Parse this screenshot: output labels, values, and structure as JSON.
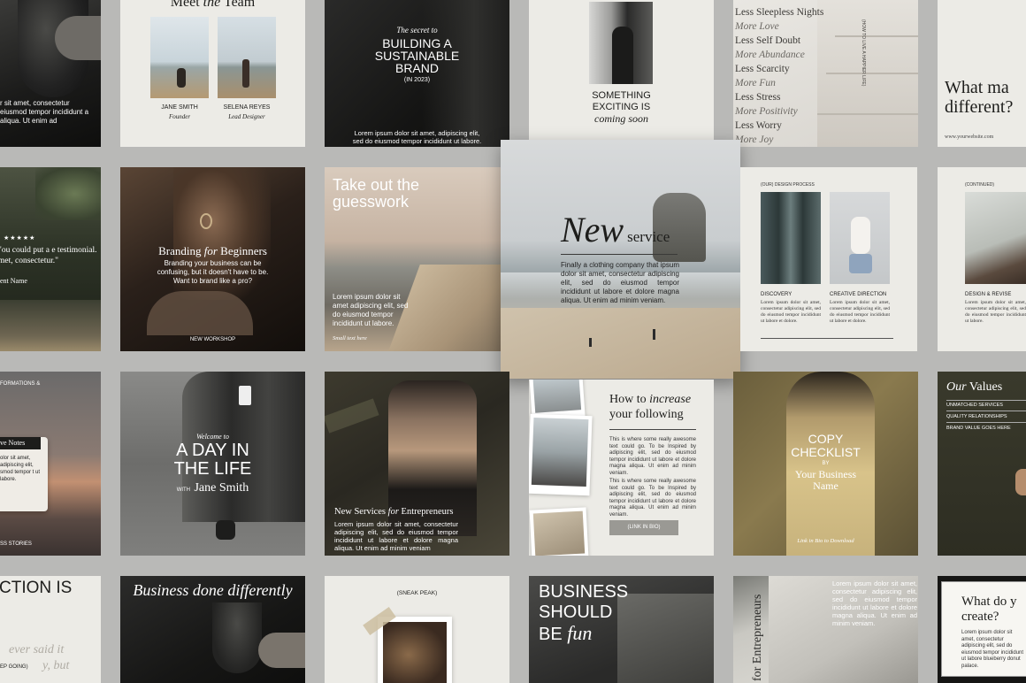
{
  "colors": {
    "background": "#b9b9b7",
    "cream": "#ecebe6",
    "dark": "#222220",
    "olive": "#3b3a30"
  },
  "t1": {
    "text": "r sit amet, consectetur eiusmod tempor incididunt a aliqua. Ut enim ad"
  },
  "t2": {
    "title_a": "Meet",
    "title_b": "the",
    "title_c": "Team",
    "p1_name": "JANE SMITH",
    "p1_role": "Founder",
    "p2_name": "SELENA REYES",
    "p2_role": "Lead Designer"
  },
  "t3": {
    "kicker": "The secret to",
    "headline1": "BUILDING A",
    "headline2": "SUSTAINABLE",
    "headline3": "BRAND",
    "year": "(IN 2023)",
    "body": "Lorem ipsum dolor sit amet, adipiscing elit, sed do eiusmod tempor incididunt ut labore."
  },
  "t4": {
    "line1": "SOMETHING",
    "line2": "EXCITING IS",
    "line3": "coming soon"
  },
  "t5": {
    "items": [
      "Less Stress",
      "More Love",
      "Less Self Doubt",
      "More Abundance",
      "Less Scarcity",
      "More Fun",
      "Less Stress",
      "More Positivity",
      "Less Worry",
      "More Joy"
    ],
    "top_item": "Less Sleepless Nights",
    "side_text": "(HOW TO LIVE A HAPPIER LIFE)"
  },
  "t6": {
    "title1": "What ma",
    "title2": "different?",
    "url": "www.yourwebsite.com"
  },
  "t7": {
    "stars": "★★★★★",
    "quote": "\"ou could put a e testimonial. met, consectetur.\"",
    "name": "ent Name"
  },
  "t8": {
    "title_a": "Branding",
    "title_b": "for",
    "title_c": "Beginners",
    "body": "Branding your business can be confusing, but it doesn't have to be. Want to brand like a pro?",
    "footer": "NEW WORKSHOP"
  },
  "t9": {
    "headline1": "Take out the",
    "headline2": "guesswork",
    "body": "Lorem ipsum dolor sit amet adipiscing elit, sed do eiusmod tempor incididunt ut labore.",
    "footer": "Small text here"
  },
  "t10": {
    "title_a": "New",
    "title_b": "service",
    "body": "Finally a clothing company that ipsum dolor sit amet, consectetur adipiscing elit, sed do eiusmod tempor incididunt ut labore et dolore magna aliqua. Ut enim ad minim veniam."
  },
  "t11": {
    "kicker": "(OUR) DESIGN PROCESS",
    "col1_title": "DISCOVERY",
    "col2_title": "CREATIVE DIRECTION",
    "col_body": "Lorem ipsum dolor sit amet, consectetur adipiscing elit, sed do eiusmod tempor incididunt ut labore et dolore."
  },
  "t12": {
    "kicker": "(CONTINUED)",
    "title": "DESIGN & REVISE",
    "body": "Lorem ipsum dolor sit amet, consectetur adipiscing elit, sed do eiusmod tempor incididunt ut labore."
  },
  "t13": {
    "header": "FORMATIONS &",
    "note_title": "ve Notes",
    "note_body": "olor sit amet, adipiscing elit, smod tempor t ut labore.",
    "footer": "SS STORIES"
  },
  "t14": {
    "kicker": "Welcome to",
    "line1": "A DAY IN",
    "line2": "THE LIFE",
    "with": "WITH",
    "name": "Jane Smith"
  },
  "t15": {
    "title_a": "New Services",
    "title_b": "for",
    "title_c": "Entrepreneurs",
    "body": "Lorem ipsum dolor sit amet, consectetur adipiscing elit, sed do eiusmod tempor incididunt ut labore et dolore magna aliqua. Ut enim ad minim veniam"
  },
  "t16": {
    "title1": "How to",
    "title_em": "increase",
    "title2": "your following",
    "para1": "This is where some really awesome text could go. To be Inspired by adipiscing elit, sed do eiusmod tempor incididunt ut labore et dolore magna aliqua. Ut enim ad minim veniam.",
    "para2": "This is where some really awesome text could go. To be Inspired by adipiscing elit, sed do eiusmod tempor incididunt ut labore et dolore magna aliqua. Ut enim ad minim veniam.",
    "button": "(LINK IN BIO)"
  },
  "t17": {
    "line1": "COPY",
    "line2": "CHECKLIST",
    "by": "BY",
    "name1": "Your Business",
    "name2": "Name",
    "footer": "Link in Bio to Download"
  },
  "t18": {
    "title_a": "Our",
    "title_b": "Values",
    "items": [
      "UNMATCHED SERVICES",
      "QUALITY RELATIONSHIPS",
      "BRAND VALUE GOES HERE"
    ]
  },
  "t19": {
    "headline": "CTION IS",
    "script1": "ever said it",
    "script2": "EP GOING)",
    "script3": "y, but"
  },
  "t20": {
    "headline": "Business done differently"
  },
  "t21": {
    "kicker": "(SNEAK PEAK)"
  },
  "t22": {
    "line1": "BUSINESS",
    "line2": "SHOULD",
    "line3": "BE",
    "line3_em": "fun"
  },
  "t23": {
    "side": "s for Entrepreneurs",
    "body": "Lorem ipsum dolor sit amet, consectetur adipiscing elit, sed do eiusmod tempor incididunt ut labore et dolore magna aliqua. Ut enim ad minim veniam."
  },
  "t24": {
    "title1": "What do y",
    "title2": "create?",
    "body": "Lorem ipsum dolor sit amet, consectetur adipiscing elit, sed do eiusmod tempor incididunt ut labore blueberry donut palace."
  }
}
